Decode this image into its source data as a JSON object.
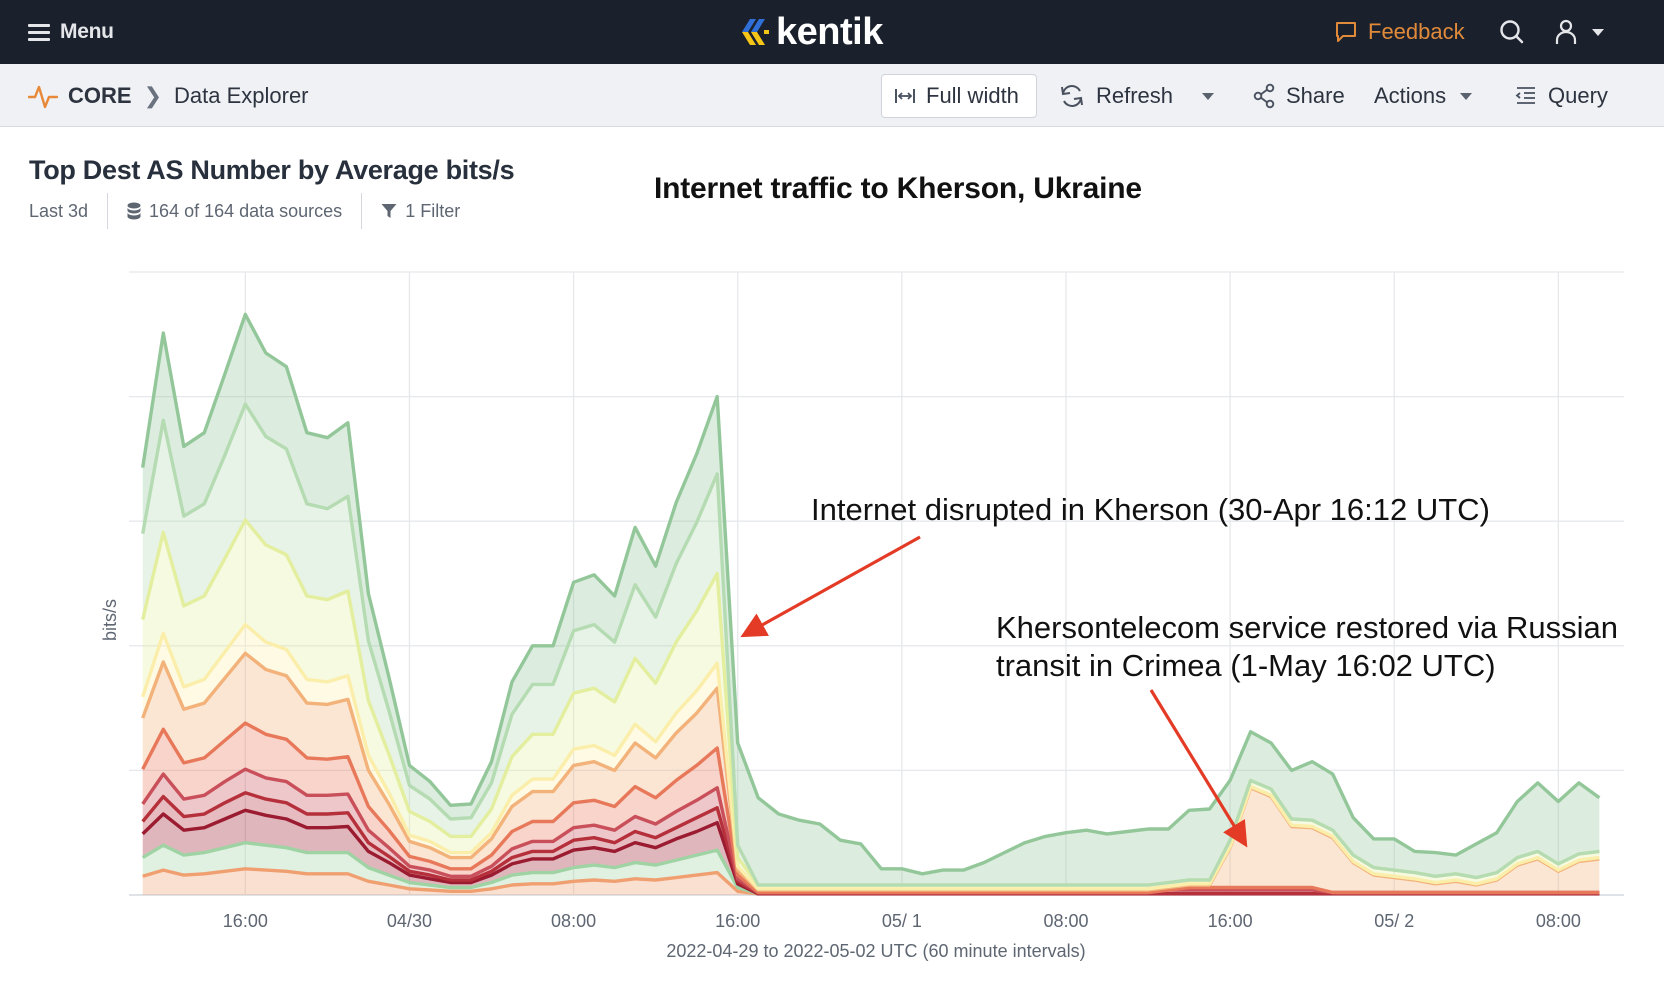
{
  "topnav": {
    "menu_label": "Menu",
    "logo_text": "kentik",
    "feedback_label": "Feedback",
    "colors": {
      "background": "#1b212c",
      "feedback": "#e08a3a",
      "logo_blue": "#2f6fd6",
      "logo_yellow": "#f5c518"
    }
  },
  "subnav": {
    "breadcrumb": {
      "section": "CORE",
      "page": "Data Explorer"
    },
    "buttons": {
      "full_width": "Full width",
      "refresh": "Refresh",
      "share": "Share",
      "actions": "Actions",
      "query": "Query"
    }
  },
  "panel": {
    "title": "Top Dest AS Number by Average bits/s",
    "time_range": "Last 3d",
    "data_sources": "164 of 164 data sources",
    "filters": "1 Filter"
  },
  "annotations": {
    "headline": "Internet traffic to Kherson, Ukraine",
    "disruption": "Internet disrupted in Kherson (30-Apr 16:12 UTC)",
    "restored_line1": "Khersontelecom service restored via Russian",
    "restored_line2": "transit in Crimea (1-May 16:02 UTC)",
    "arrow_color": "#e33b25"
  },
  "chart_data": {
    "type": "area",
    "stacked": true,
    "title": "Top Dest AS Number by Average bits/s",
    "xlabel": "2022-04-29 to 2022-05-02 UTC (60 minute intervals)",
    "ylabel": "bits/s",
    "y_units_note": "relative units (y-axis carries no numeric tick labels); 1 unit = 1 gridline",
    "ylim": [
      0,
      5
    ],
    "y_gridlines": [
      1,
      2,
      3,
      4,
      5
    ],
    "grid": true,
    "legend": "none",
    "x_start": "2022-04-29 11:00 UTC",
    "x_interval_minutes": 60,
    "x_domain_hours": [
      -0.67,
      72.2
    ],
    "x_ticks": [
      {
        "hour": 5,
        "label": "16:00"
      },
      {
        "hour": 13,
        "label": "04/30"
      },
      {
        "hour": 21,
        "label": "08:00"
      },
      {
        "hour": 29,
        "label": "16:00"
      },
      {
        "hour": 37,
        "label": "05/ 1"
      },
      {
        "hour": 45,
        "label": "08:00"
      },
      {
        "hour": 53,
        "label": "16:00"
      },
      {
        "hour": 61,
        "label": "05/ 2"
      },
      {
        "hour": 69,
        "label": "08:00"
      }
    ],
    "annotation_points": [
      {
        "name": "disruption",
        "hour": 29.2,
        "value": 2.0
      },
      {
        "name": "restored",
        "hour": 53.5,
        "value": 0.35
      }
    ],
    "series": [
      {
        "name": "series-11",
        "color": "#f0a070",
        "values": [
          0.15,
          0.2,
          0.16,
          0.17,
          0.19,
          0.21,
          0.2,
          0.19,
          0.17,
          0.17,
          0.17,
          0.11,
          0.08,
          0.05,
          0.04,
          0.03,
          0.03,
          0.05,
          0.08,
          0.09,
          0.09,
          0.11,
          0.12,
          0.11,
          0.13,
          0.12,
          0.14,
          0.16,
          0.18,
          0.03,
          0.01,
          0.01,
          0.01,
          0.01,
          0.01,
          0.01,
          0.01,
          0.01,
          0.01,
          0.01,
          0.01,
          0.01,
          0.01,
          0.01,
          0.01,
          0.01,
          0.01,
          0.01,
          0.01,
          0.01,
          0.01,
          0.01,
          0.01,
          0.01,
          0.01,
          0.01,
          0.01,
          0.01,
          0.01,
          0.01,
          0.01,
          0.01,
          0.01,
          0.01,
          0.01,
          0.01,
          0.01,
          0.01,
          0.01,
          0.01,
          0.01,
          0.01
        ]
      },
      {
        "name": "series-10",
        "color": "#9fd3a4",
        "values": [
          0.15,
          0.2,
          0.16,
          0.17,
          0.19,
          0.21,
          0.2,
          0.19,
          0.17,
          0.17,
          0.17,
          0.11,
          0.08,
          0.05,
          0.04,
          0.03,
          0.03,
          0.05,
          0.08,
          0.09,
          0.09,
          0.11,
          0.12,
          0.11,
          0.13,
          0.12,
          0.14,
          0.16,
          0.18,
          0.03,
          0,
          0,
          0,
          0,
          0,
          0,
          0,
          0,
          0,
          0,
          0,
          0,
          0,
          0,
          0,
          0,
          0,
          0,
          0,
          0,
          0,
          0,
          0,
          0,
          0,
          0,
          0,
          0,
          0,
          0,
          0,
          0,
          0,
          0,
          0,
          0,
          0,
          0,
          0,
          0,
          0,
          0
        ]
      },
      {
        "name": "series-9",
        "color": "#9b1b30",
        "values": [
          0.19,
          0.25,
          0.2,
          0.2,
          0.23,
          0.26,
          0.24,
          0.23,
          0.2,
          0.2,
          0.21,
          0.13,
          0.1,
          0.06,
          0.05,
          0.04,
          0.04,
          0.06,
          0.09,
          0.11,
          0.11,
          0.14,
          0.14,
          0.13,
          0.16,
          0.14,
          0.17,
          0.19,
          0.22,
          0.03,
          0,
          0,
          0,
          0,
          0,
          0,
          0,
          0,
          0,
          0,
          0,
          0,
          0,
          0,
          0,
          0,
          0,
          0,
          0,
          0,
          0,
          0,
          0,
          0,
          0,
          0,
          0,
          0,
          0,
          0,
          0,
          0,
          0,
          0,
          0,
          0,
          0,
          0,
          0,
          0,
          0,
          0
        ]
      },
      {
        "name": "series-8",
        "color": "#b5303a",
        "values": [
          0.1,
          0.14,
          0.11,
          0.11,
          0.13,
          0.14,
          0.13,
          0.13,
          0.11,
          0.11,
          0.11,
          0.07,
          0.05,
          0.03,
          0.03,
          0.02,
          0.02,
          0.03,
          0.05,
          0.06,
          0.06,
          0.08,
          0.08,
          0.07,
          0.09,
          0.08,
          0.09,
          0.11,
          0.12,
          0.02,
          0,
          0,
          0,
          0,
          0,
          0,
          0,
          0,
          0,
          0,
          0,
          0,
          0,
          0,
          0,
          0,
          0,
          0,
          0,
          0,
          0,
          0,
          0,
          0,
          0,
          0,
          0,
          0,
          0,
          0,
          0,
          0,
          0,
          0,
          0,
          0,
          0,
          0,
          0,
          0,
          0,
          0
        ]
      },
      {
        "name": "series-7",
        "color": "#c9505a",
        "values": [
          0.14,
          0.18,
          0.14,
          0.15,
          0.17,
          0.19,
          0.17,
          0.17,
          0.15,
          0.15,
          0.15,
          0.1,
          0.07,
          0.04,
          0.04,
          0.03,
          0.03,
          0.04,
          0.07,
          0.08,
          0.08,
          0.1,
          0.1,
          0.1,
          0.12,
          0.11,
          0.13,
          0.14,
          0.16,
          0.02,
          0.01,
          0.01,
          0.01,
          0.01,
          0.01,
          0.01,
          0.01,
          0.01,
          0.01,
          0.01,
          0.01,
          0.01,
          0.01,
          0.01,
          0.01,
          0.01,
          0.01,
          0.01,
          0.01,
          0.01,
          0.03,
          0.03,
          0.03,
          0.03,
          0.03,
          0.03,
          0.03,
          0.03,
          0.01,
          0.01,
          0.01,
          0.01,
          0.01,
          0.01,
          0.01,
          0.01,
          0.01,
          0.01,
          0.01,
          0.01,
          0.01,
          0.01
        ]
      },
      {
        "name": "series-6",
        "color": "#e8785a",
        "values": [
          0.28,
          0.36,
          0.29,
          0.3,
          0.33,
          0.37,
          0.35,
          0.34,
          0.3,
          0.29,
          0.3,
          0.19,
          0.14,
          0.08,
          0.07,
          0.06,
          0.06,
          0.09,
          0.14,
          0.16,
          0.16,
          0.2,
          0.2,
          0.19,
          0.24,
          0.21,
          0.25,
          0.28,
          0.32,
          0.03,
          0,
          0,
          0,
          0,
          0,
          0,
          0,
          0,
          0,
          0,
          0,
          0,
          0,
          0,
          0,
          0,
          0,
          0,
          0,
          0,
          0,
          0.02,
          0.02,
          0.02,
          0.02,
          0.02,
          0.02,
          0.02,
          0,
          0,
          0,
          0,
          0,
          0,
          0,
          0,
          0,
          0,
          0,
          0,
          0,
          0
        ]
      },
      {
        "name": "series-5",
        "color": "#f2b27a",
        "values": [
          0.41,
          0.54,
          0.43,
          0.44,
          0.5,
          0.56,
          0.52,
          0.51,
          0.44,
          0.44,
          0.46,
          0.29,
          0.21,
          0.12,
          0.11,
          0.09,
          0.09,
          0.13,
          0.2,
          0.24,
          0.24,
          0.3,
          0.31,
          0.29,
          0.35,
          0.32,
          0.38,
          0.42,
          0.48,
          0.04,
          0.02,
          0.02,
          0.02,
          0.02,
          0.02,
          0.02,
          0.02,
          0.02,
          0.02,
          0.02,
          0.02,
          0.02,
          0.02,
          0.02,
          0.02,
          0.02,
          0.02,
          0.02,
          0.02,
          0.02,
          0.02,
          0.02,
          0.02,
          0.32,
          0.8,
          0.73,
          0.49,
          0.48,
          0.44,
          0.24,
          0.14,
          0.12,
          0.1,
          0.07,
          0.09,
          0.06,
          0.1,
          0.22,
          0.27,
          0.17,
          0.25,
          0.27
        ]
      },
      {
        "name": "series-4",
        "color": "#fbeeaa",
        "values": [
          0.17,
          0.23,
          0.18,
          0.19,
          0.21,
          0.23,
          0.22,
          0.21,
          0.19,
          0.18,
          0.19,
          0.12,
          0.09,
          0.05,
          0.05,
          0.04,
          0.04,
          0.05,
          0.09,
          0.1,
          0.1,
          0.13,
          0.13,
          0.12,
          0.15,
          0.13,
          0.16,
          0.18,
          0.2,
          0.03,
          0.01,
          0.01,
          0.01,
          0.01,
          0.01,
          0.01,
          0.01,
          0.01,
          0.01,
          0.01,
          0.01,
          0.01,
          0.01,
          0.01,
          0.01,
          0.01,
          0.01,
          0.01,
          0.01,
          0.01,
          0.01,
          0.01,
          0.01,
          0.01,
          0.01,
          0.01,
          0.01,
          0.01,
          0.01,
          0.01,
          0.01,
          0.01,
          0.01,
          0.01,
          0.01,
          0.01,
          0.01,
          0.01,
          0.01,
          0.01,
          0.01,
          0.01
        ]
      },
      {
        "name": "series-3",
        "color": "#e3ee9e",
        "values": [
          0.62,
          0.81,
          0.65,
          0.67,
          0.75,
          0.84,
          0.78,
          0.76,
          0.67,
          0.66,
          0.68,
          0.44,
          0.31,
          0.19,
          0.16,
          0.13,
          0.13,
          0.19,
          0.31,
          0.36,
          0.36,
          0.45,
          0.46,
          0.43,
          0.53,
          0.47,
          0.57,
          0.64,
          0.72,
          0.07,
          0.03,
          0.03,
          0.03,
          0.03,
          0.03,
          0.03,
          0.03,
          0.03,
          0.03,
          0.03,
          0.03,
          0.03,
          0.03,
          0.03,
          0.03,
          0.03,
          0.03,
          0.03,
          0.03,
          0.03,
          0.03,
          0.03,
          0.03,
          0.05,
          0.05,
          0.05,
          0.05,
          0.05,
          0.05,
          0.05,
          0.05,
          0.05,
          0.05,
          0.05,
          0.05,
          0.05,
          0.05,
          0.05,
          0.05,
          0.05,
          0.05,
          0.05
        ]
      },
      {
        "name": "series-2",
        "color": "#b5dbb2",
        "values": [
          0.69,
          0.9,
          0.72,
          0.74,
          0.83,
          0.93,
          0.87,
          0.85,
          0.74,
          0.73,
          0.76,
          0.48,
          0.35,
          0.21,
          0.18,
          0.14,
          0.15,
          0.21,
          0.34,
          0.4,
          0.4,
          0.5,
          0.51,
          0.48,
          0.59,
          0.53,
          0.63,
          0.71,
          0.8,
          0.1,
          0,
          0,
          0,
          0,
          0,
          0,
          0,
          0,
          0,
          0,
          0,
          0,
          0,
          0,
          0,
          0,
          0,
          0,
          0,
          0,
          0,
          0,
          0,
          0,
          0,
          0,
          0,
          0,
          0,
          0,
          0,
          0,
          0,
          0,
          0,
          0,
          0,
          0,
          0,
          0,
          0,
          0
        ]
      },
      {
        "name": "series-1",
        "color": "#93c79a",
        "values": [
          0.53,
          0.7,
          0.56,
          0.57,
          0.65,
          0.72,
          0.67,
          0.66,
          0.57,
          0.57,
          0.59,
          0.38,
          0.27,
          0.16,
          0.14,
          0.11,
          0.11,
          0.17,
          0.26,
          0.31,
          0.31,
          0.39,
          0.4,
          0.37,
          0.46,
          0.41,
          0.49,
          0.55,
          0.62,
          0.82,
          0.7,
          0.57,
          0.52,
          0.49,
          0.36,
          0.33,
          0.13,
          0.13,
          0.09,
          0.12,
          0.12,
          0.18,
          0.26,
          0.34,
          0.39,
          0.42,
          0.44,
          0.41,
          0.43,
          0.45,
          0.43,
          0.56,
          0.57,
          0.48,
          0.39,
          0.37,
          0.39,
          0.47,
          0.45,
          0.3,
          0.23,
          0.25,
          0.17,
          0.19,
          0.15,
          0.27,
          0.32,
          0.45,
          0.55,
          0.5,
          0.57,
          0.43
        ]
      }
    ]
  }
}
